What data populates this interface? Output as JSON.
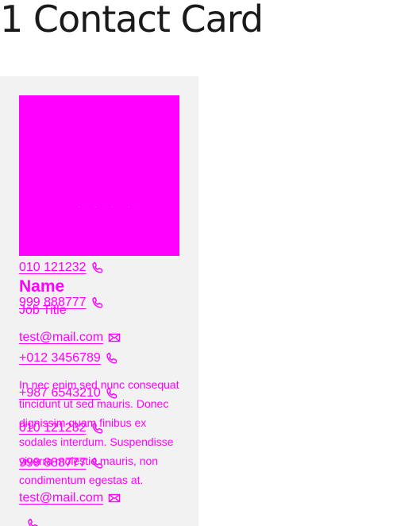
{
  "page": {
    "title": "1 Contact Card"
  },
  "card": {
    "name": "Name",
    "job_title": "Job Title",
    "bio": "In nec enim sed nunc consequat tincidunt ut sed mauris. Donec dignissim quam finibus ex sodales interdum. Suspendisse viverra molestie mauris, non condimentum egestas at.",
    "contacts_top": [
      {
        "label": "010 121232",
        "icon": "phone-icon"
      },
      {
        "label": "999 888777",
        "icon": "phone-icon"
      },
      {
        "label": "test@mail.com",
        "icon": "mail-icon"
      },
      {
        "label": "+012 3456789",
        "icon": "phone-icon"
      },
      {
        "label": "+987 6543210",
        "icon": "phone-icon"
      }
    ],
    "contacts_bottom": [
      {
        "label": "010 121232",
        "icon": "phone-icon"
      },
      {
        "label": "999 888777",
        "icon": "phone-icon"
      },
      {
        "label": "test@mail.com",
        "icon": "mail-icon"
      }
    ]
  },
  "colors": {
    "accent": "#ff00ff",
    "card_bg": "#f2f2f2",
    "title": "#1a1a1a"
  }
}
